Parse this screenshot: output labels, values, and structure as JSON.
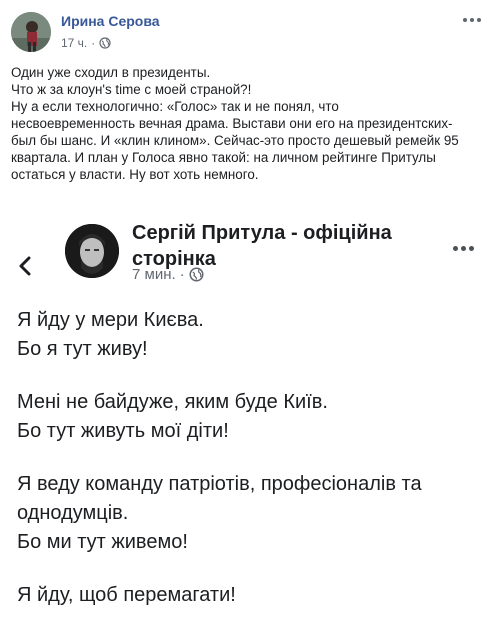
{
  "post": {
    "author": "Ирина Серова",
    "time": "17 ч.",
    "text_lines": [
      "Один уже сходил в президенты.",
      "Что ж за клоун's time с моей страной?!",
      "Ну а если технологично: «Голос» так и не понял, что",
      "несвоевременность вечная драма. Выстави они его на президентских-",
      "был бы шанс. И «клин клином». Сейчас-это просто дешевый ремейк 95",
      "квартала. И план у Голоса явно такой: на личном рейтинге Притулы",
      "остаться у власти. Ну вот хоть немного."
    ]
  },
  "shared": {
    "author": "Сергій Притула - офіційна сторінка",
    "time": "7 мин.",
    "paragraphs": [
      [
        "Я йду у мери Києва.",
        "Бо я тут живу!"
      ],
      [
        "Мені не байдуже, яким буде Київ.",
        "Бо тут живуть мої діти!"
      ],
      [
        "Я веду команду патріотів, професіоналів та",
        "однодумців.",
        "Бо ми тут живемо!"
      ],
      [
        "Я йду, щоб перемагати!"
      ]
    ]
  },
  "colors": {
    "name_link": "#385898",
    "meta_gray": "#616770",
    "text": "#1c1e21"
  },
  "icons": {
    "privacy": "globe-icon",
    "back": "chevron-left-icon",
    "menu": "more-options-icon"
  }
}
